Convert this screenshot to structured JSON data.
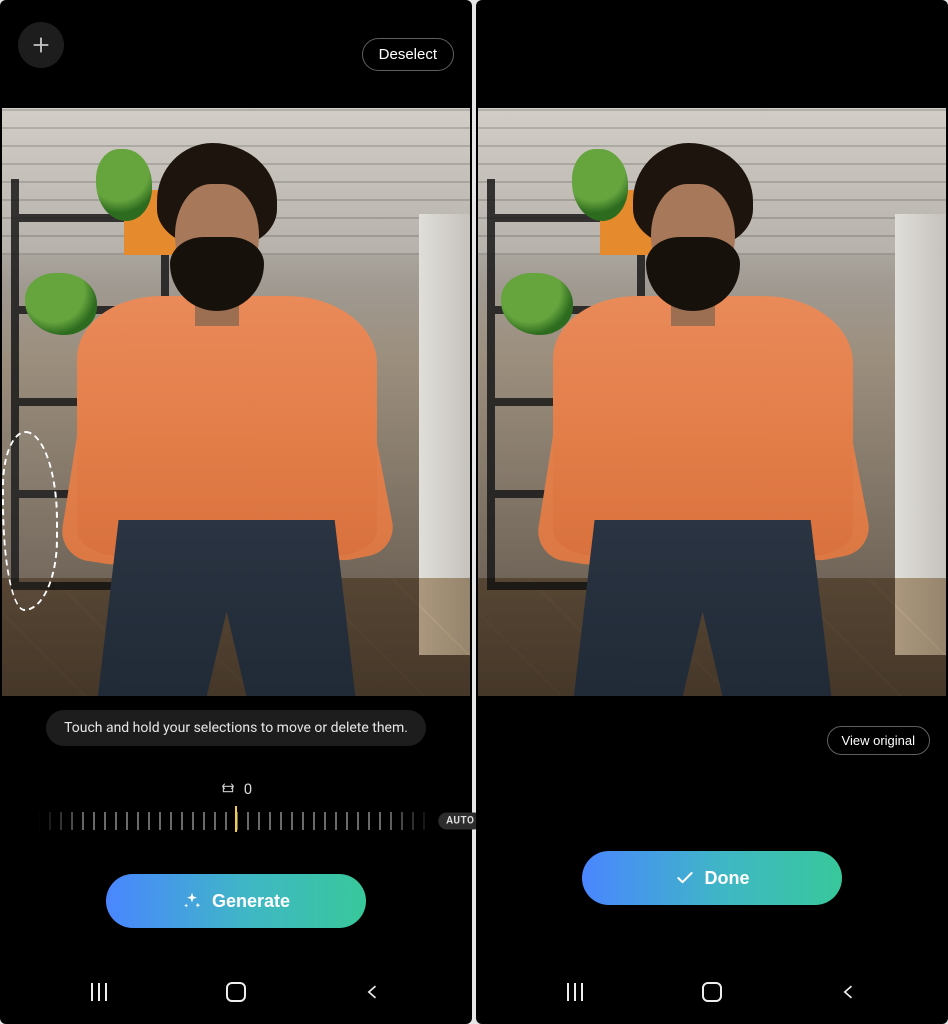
{
  "left": {
    "deselect_label": "Deselect",
    "hint_text": "Touch and hold your selections to move or delete them.",
    "angle_value": "0",
    "auto_label": "AUTO",
    "generate_label": "Generate",
    "icons": {
      "add": "plus-icon",
      "straighten": "straighten-icon",
      "sparkle": "sparkle-icon"
    }
  },
  "right": {
    "view_original_label": "View original",
    "done_label": "Done",
    "icons": {
      "check": "check-icon"
    }
  },
  "nav": {
    "recents": "recents",
    "home": "home",
    "back": "back"
  }
}
